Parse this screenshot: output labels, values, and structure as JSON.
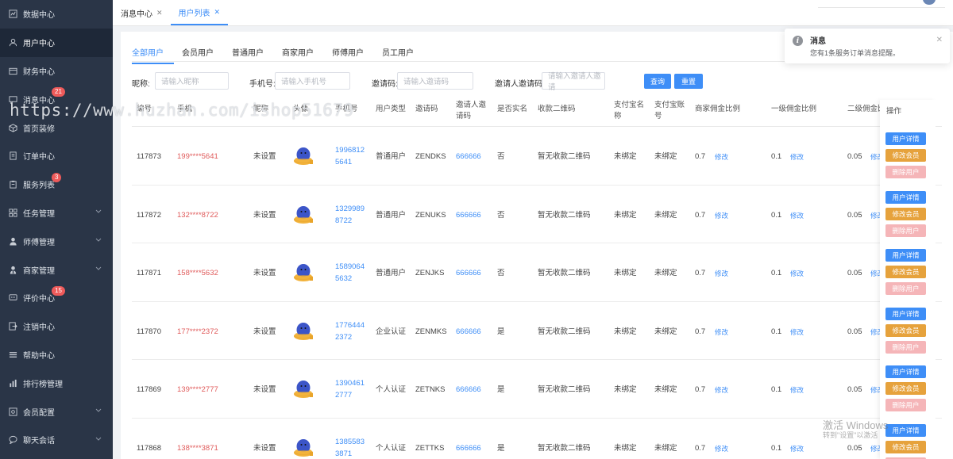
{
  "sidebar": {
    "items": [
      {
        "label": "数据中心",
        "icon": "chart-icon",
        "badge": null,
        "chevron": false,
        "active": false
      },
      {
        "label": "用户中心",
        "icon": "user-icon",
        "badge": null,
        "chevron": false,
        "active": true
      },
      {
        "label": "财务中心",
        "icon": "wallet-icon",
        "badge": null,
        "chevron": false,
        "active": false
      },
      {
        "label": "消息中心",
        "icon": "message-icon",
        "badge": "21",
        "chevron": false,
        "active": false
      },
      {
        "label": "首页装修",
        "icon": "cube-icon",
        "badge": null,
        "chevron": false,
        "active": false
      },
      {
        "label": "订单中心",
        "icon": "document-icon",
        "badge": null,
        "chevron": false,
        "active": false
      },
      {
        "label": "服务列表",
        "icon": "clipboard-icon",
        "badge": "3",
        "chevron": false,
        "active": false
      },
      {
        "label": "任务管理",
        "icon": "grid-icon",
        "badge": null,
        "chevron": true,
        "active": false
      },
      {
        "label": "师傅管理",
        "icon": "person-icon",
        "badge": null,
        "chevron": true,
        "active": false
      },
      {
        "label": "商家管理",
        "icon": "merchant-icon",
        "badge": null,
        "chevron": true,
        "active": false
      },
      {
        "label": "评价中心",
        "icon": "comment-icon",
        "badge": "15",
        "chevron": false,
        "active": false
      },
      {
        "label": "注销中心",
        "icon": "logout-icon",
        "badge": null,
        "chevron": false,
        "active": false
      },
      {
        "label": "帮助中心",
        "icon": "list-icon",
        "badge": null,
        "chevron": false,
        "active": false
      },
      {
        "label": "排行榜管理",
        "icon": "bar-chart-icon",
        "badge": null,
        "chevron": false,
        "active": false
      },
      {
        "label": "会员配置",
        "icon": "settings-icon",
        "badge": null,
        "chevron": true,
        "active": false
      },
      {
        "label": "聊天会话",
        "icon": "chat-icon",
        "badge": null,
        "chevron": true,
        "active": false
      }
    ]
  },
  "tabbar": {
    "tabs": [
      {
        "label": "消息中心",
        "close": "✕",
        "active": false
      },
      {
        "label": "用户列表",
        "close": "✕",
        "active": true
      }
    ]
  },
  "user_tabs": [
    "全部用户",
    "会员用户",
    "普通用户",
    "商家用户",
    "师傅用户",
    "员工用户"
  ],
  "filters": {
    "nickname_label": "昵称:",
    "nickname_placeholder": "请输入昵称",
    "phone_label": "手机号:",
    "phone_placeholder": "请输入手机号",
    "invite_label": "邀请码:",
    "invite_placeholder": "请输入邀请码",
    "inviter_label": "邀请人邀请码:",
    "inviter_placeholder": "请输入邀请人邀请",
    "search_button": "查询",
    "reset_button": "重置"
  },
  "table": {
    "headers": {
      "id": "编号",
      "phone": "手机",
      "nickname": "昵称",
      "avatar": "头像",
      "mobile": "手机号",
      "user_type": "用户类型",
      "invite_code": "邀请码",
      "inviter_code": "邀请人邀请码",
      "verified": "是否实名",
      "qr": "收款二维码",
      "alipay_name": "支付宝名称",
      "alipay_account": "支付宝账号",
      "merchant_ratio": "商家佣金比例",
      "level1_ratio": "一级佣金比例",
      "level2_ratio": "二级佣金比例",
      "ops": "操作"
    },
    "rows": [
      {
        "id": "117873",
        "phone": "199****5641",
        "nickname": "未设置",
        "mobile": "1996812 5641",
        "mobile_a": "1996812",
        "mobile_b": "5641",
        "user_type": "普通用户",
        "invite_code": "ZENDKS",
        "inviter_code": "666666",
        "verified": "否",
        "qr": "暂无收款二维码",
        "alipay_name": "未绑定",
        "alipay_account": "未绑定",
        "merchant_ratio": "0.7",
        "level1_ratio": "0.1",
        "level2_ratio": "0.05",
        "edit": "修改"
      },
      {
        "id": "117872",
        "phone": "132****8722",
        "nickname": "未设置",
        "mobile_a": "1329989",
        "mobile_b": "8722",
        "user_type": "普通用户",
        "invite_code": "ZENUKS",
        "inviter_code": "666666",
        "verified": "否",
        "qr": "暂无收款二维码",
        "alipay_name": "未绑定",
        "alipay_account": "未绑定",
        "merchant_ratio": "0.7",
        "level1_ratio": "0.1",
        "level2_ratio": "0.05",
        "edit": "修改"
      },
      {
        "id": "117871",
        "phone": "158****5632",
        "nickname": "未设置",
        "mobile_a": "1589064",
        "mobile_b": "5632",
        "user_type": "普通用户",
        "invite_code": "ZENJKS",
        "inviter_code": "666666",
        "verified": "否",
        "qr": "暂无收款二维码",
        "alipay_name": "未绑定",
        "alipay_account": "未绑定",
        "merchant_ratio": "0.7",
        "level1_ratio": "0.1",
        "level2_ratio": "0.05",
        "edit": "修改"
      },
      {
        "id": "117870",
        "phone": "177****2372",
        "nickname": "未设置",
        "mobile_a": "1776444",
        "mobile_b": "2372",
        "user_type": "企业认证",
        "invite_code": "ZENMKS",
        "inviter_code": "666666",
        "verified": "是",
        "qr": "暂无收款二维码",
        "alipay_name": "未绑定",
        "alipay_account": "未绑定",
        "merchant_ratio": "0.7",
        "level1_ratio": "0.1",
        "level2_ratio": "0.05",
        "edit": "修改"
      },
      {
        "id": "117869",
        "phone": "139****2777",
        "nickname": "未设置",
        "mobile_a": "1390461",
        "mobile_b": "2777",
        "user_type": "个人认证",
        "invite_code": "ZETNKS",
        "inviter_code": "666666",
        "verified": "是",
        "qr": "暂无收款二维码",
        "alipay_name": "未绑定",
        "alipay_account": "未绑定",
        "merchant_ratio": "0.7",
        "level1_ratio": "0.1",
        "level2_ratio": "0.05",
        "edit": "修改"
      },
      {
        "id": "117868",
        "phone": "138****3871",
        "nickname": "未设置",
        "mobile_a": "1385583",
        "mobile_b": "3871",
        "user_type": "个人认证",
        "invite_code": "ZETTKS",
        "inviter_code": "666666",
        "verified": "是",
        "qr": "暂无收款二维码",
        "alipay_name": "未绑定",
        "alipay_account": "未绑定",
        "merchant_ratio": "0.7",
        "level1_ratio": "0.1",
        "level2_ratio": "0.05",
        "edit": "修改"
      }
    ],
    "op_buttons": {
      "detail": "用户详情",
      "member": "修改会员",
      "delete": "删除用户"
    }
  },
  "notification": {
    "title": "消息",
    "message": "您有1条服务订单消息提醒。",
    "close": "✕"
  },
  "watermark": "https://www.huzhan.com/ishop51679",
  "windows_activation": {
    "line1": "激活 Windows",
    "line2": "转到\"设置\"以激活"
  },
  "colors": {
    "sidebar_bg": "#2a3547",
    "accent_blue": "#3e8ef7",
    "phone_red": "#e05b5b",
    "btn_orange": "#e6a23c",
    "btn_pink": "#f5b5b8",
    "badge_red": "#ee5a5a"
  }
}
